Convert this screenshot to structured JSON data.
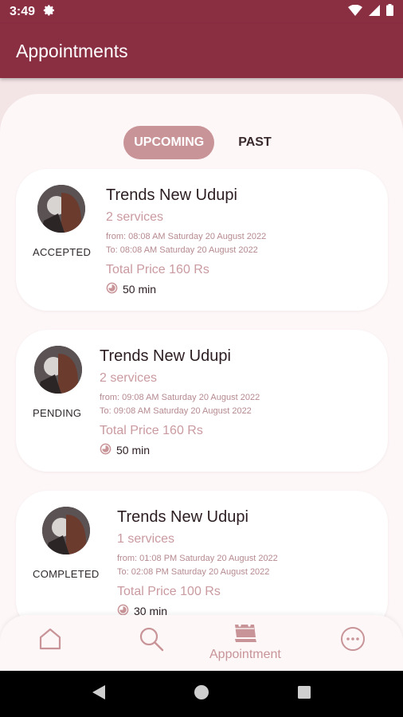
{
  "status_bar": {
    "time": "3:49"
  },
  "app_bar": {
    "title": "Appointments"
  },
  "tabs": {
    "upcoming": "UPCOMING",
    "past": "PAST"
  },
  "appointments": [
    {
      "status": "ACCEPTED",
      "shop": "Trends New Udupi",
      "services": "2 services",
      "from": "from: 08:08 AM Saturday 20 August 2022",
      "to": "To: 08:08 AM Saturday 20 August 2022",
      "price": "Total Price 160 Rs",
      "duration": "50 min"
    },
    {
      "status": "PENDING",
      "shop": "Trends New Udupi",
      "services": "2 services",
      "from": "from: 09:08 AM Saturday 20 August 2022",
      "to": "To: 09:08 AM Saturday 20 August 2022",
      "price": "Total Price 160 Rs",
      "duration": "50 min"
    },
    {
      "status": "COMPLETED",
      "shop": "Trends New Udupi",
      "services": "1 services",
      "from": "from: 01:08 PM Saturday 20 August 2022",
      "to": "To: 02:08 PM Saturday 20 August 2022",
      "price": "Total Price 100 Rs",
      "duration": "30 min"
    }
  ],
  "bottom_nav": {
    "appointment_label": "Appointment"
  },
  "colors": {
    "primary": "#8a2e42",
    "accent": "#c89498",
    "text_muted": "#c99aa0"
  }
}
